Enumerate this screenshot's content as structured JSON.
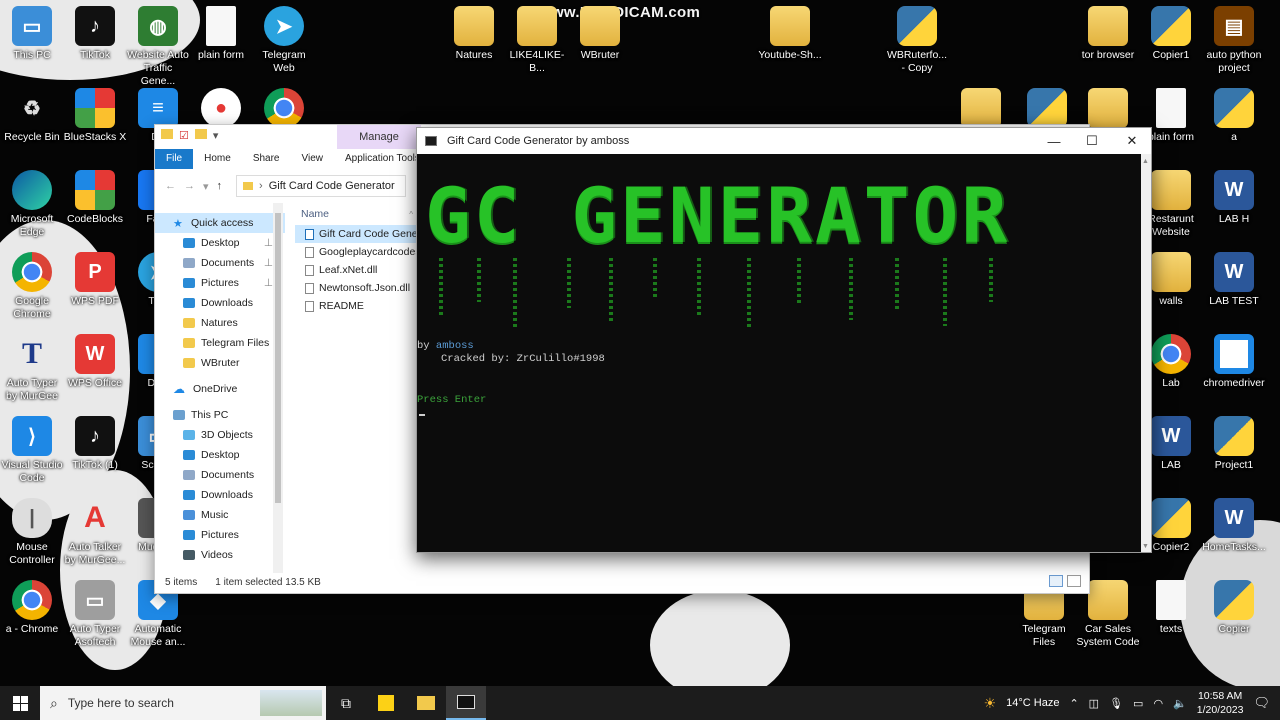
{
  "watermark": "www.BANDICAM.com",
  "desktop_icons": [
    {
      "label": "This PC"
    },
    {
      "label": "TikTok"
    },
    {
      "label": "Website Auto Traffic Gene..."
    },
    {
      "label": "plain form"
    },
    {
      "label": "Telegram Web"
    },
    {
      "label": "Natures"
    },
    {
      "label": "LIKE4LIKE-B..."
    },
    {
      "label": "WBruter"
    },
    {
      "label": "Youtube-Sh..."
    },
    {
      "label": "WBRuterfo... - Copy"
    },
    {
      "label": "tor browser"
    },
    {
      "label": "Copier1"
    },
    {
      "label": "auto python project"
    },
    {
      "label": "Recycle Bin"
    },
    {
      "label": "BlueStacks X"
    },
    {
      "label": "De"
    },
    {
      "label": "plain form"
    },
    {
      "label": "a"
    },
    {
      "label": "Microsoft Edge"
    },
    {
      "label": "CodeBlocks"
    },
    {
      "label": "Face"
    },
    {
      "label": "Restarunt Website"
    },
    {
      "label": "LAB H"
    },
    {
      "label": "Google Chrome"
    },
    {
      "label": "WPS PDF"
    },
    {
      "label": "Tele"
    },
    {
      "label": "walls"
    },
    {
      "label": "LAB TEST"
    },
    {
      "label": "Auto Typer by MurGee"
    },
    {
      "label": "WPS Office"
    },
    {
      "label": "Dow"
    },
    {
      "label": "Lab"
    },
    {
      "label": "chromedriver"
    },
    {
      "label": "Visual Studio Code"
    },
    {
      "label": "TikTok (1)"
    },
    {
      "label": "Screen"
    },
    {
      "label": "LAB"
    },
    {
      "label": "Project1"
    },
    {
      "label": "Mouse Controller"
    },
    {
      "label": "Auto Talker by MurGee..."
    },
    {
      "label": "Mud Old"
    },
    {
      "label": "Copier2"
    },
    {
      "label": "HomeTasks..."
    },
    {
      "label": "a - Chrome"
    },
    {
      "label": "Auto Typer Asoftech"
    },
    {
      "label": "Automatic Mouse an..."
    },
    {
      "label": "Telegram Files"
    },
    {
      "label": "Car Sales System Code"
    },
    {
      "label": "texts"
    },
    {
      "label": "Copier"
    }
  ],
  "explorer": {
    "manage": "Manage",
    "ribbon": [
      "File",
      "Home",
      "Share",
      "View",
      "Application Tools"
    ],
    "address": "Gift Card Code Generator",
    "nav": [
      {
        "label": "Quick access"
      },
      {
        "label": "Desktop"
      },
      {
        "label": "Documents"
      },
      {
        "label": "Pictures"
      },
      {
        "label": "Downloads"
      },
      {
        "label": "Natures"
      },
      {
        "label": "Telegram Files"
      },
      {
        "label": "WBruter"
      },
      {
        "label": "OneDrive"
      },
      {
        "label": "This PC"
      },
      {
        "label": "3D Objects"
      },
      {
        "label": "Desktop"
      },
      {
        "label": "Documents"
      },
      {
        "label": "Downloads"
      },
      {
        "label": "Music"
      },
      {
        "label": "Pictures"
      },
      {
        "label": "Videos"
      }
    ],
    "column_name": "Name",
    "files": [
      "Gift Card Code Genera",
      "Googleplaycardcodes",
      "Leaf.xNet.dll",
      "Newtonsoft.Json.dll",
      "README"
    ],
    "status_items": "5 items",
    "status_selected": "1 item selected  13.5 KB"
  },
  "console": {
    "title": "Gift Card Code Generator by amboss",
    "banner": "GC GENERATOR",
    "by_prefix": "by",
    "by_author": "amboss",
    "cracked": "Cracked by: ZrCulillo#1998",
    "prompt": "Press Enter"
  },
  "taskbar": {
    "search_placeholder": "Type here to search",
    "weather": "14°C  Haze",
    "time": "10:58 AM",
    "date": "1/20/2023"
  }
}
